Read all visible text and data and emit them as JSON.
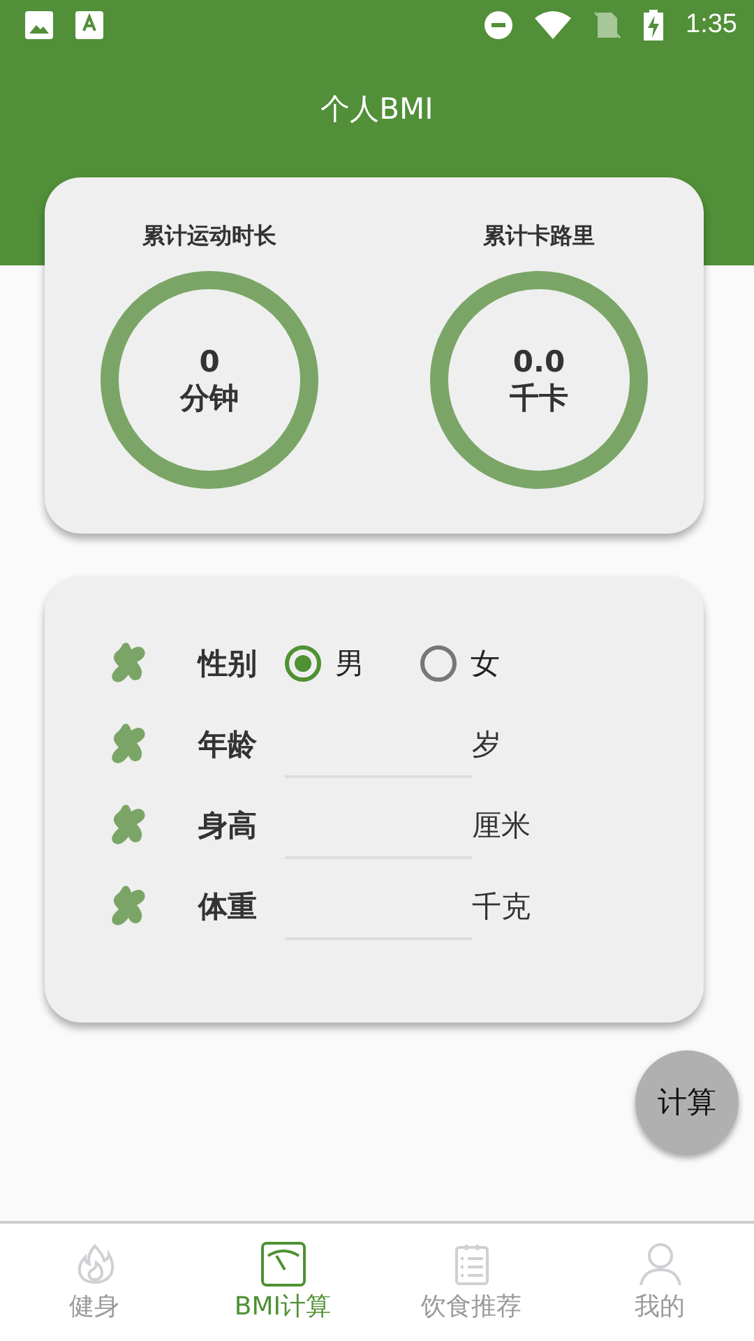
{
  "status_bar": {
    "time": "1:35"
  },
  "header": {
    "title": "个人BMI"
  },
  "stats": [
    {
      "label": "累计运动时长",
      "value": "0",
      "unit": "分钟"
    },
    {
      "label": "累计卡路里",
      "value": "0.0",
      "unit": "千卡"
    }
  ],
  "gender": {
    "label": "性别",
    "options": [
      {
        "label": "男",
        "selected": true
      },
      {
        "label": "女",
        "selected": false
      }
    ]
  },
  "fields": [
    {
      "label": "年龄",
      "unit": "岁"
    },
    {
      "label": "身高",
      "unit": "厘米"
    },
    {
      "label": "体重",
      "unit": "千克"
    }
  ],
  "calculate_button": "计算",
  "bottom_nav": [
    {
      "label": "健身",
      "kind": "flame",
      "selected": false
    },
    {
      "label": "BMI计算",
      "kind": "gauge",
      "selected": true
    },
    {
      "label": "饮食推荐",
      "kind": "list",
      "selected": false
    },
    {
      "label": "我的",
      "kind": "person",
      "selected": false
    }
  ]
}
